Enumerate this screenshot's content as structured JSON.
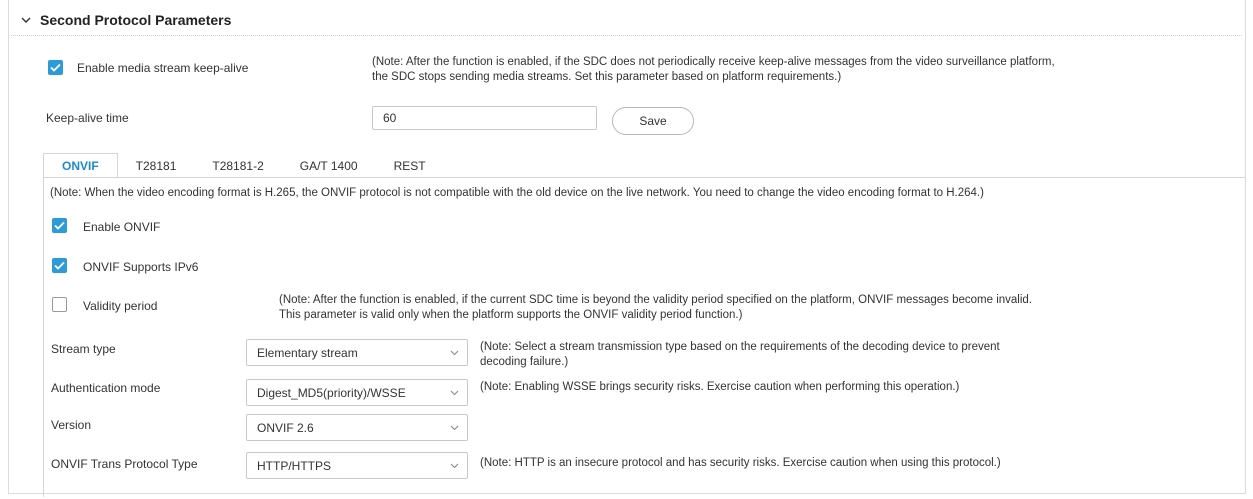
{
  "section": {
    "title": "Second Protocol Parameters"
  },
  "keepalive": {
    "enable_label": "Enable media stream keep-alive",
    "enabled": true,
    "note_line1": "(Note: After the function is enabled, if the SDC does not periodically receive keep-alive messages from the video surveillance platform,",
    "note_line2": "the SDC stops sending media streams. Set this parameter based on platform requirements.)",
    "time_label": "Keep-alive time",
    "time_value": "60",
    "save_label": "Save"
  },
  "tabs": [
    {
      "label": "ONVIF",
      "active": true
    },
    {
      "label": "T28181",
      "active": false
    },
    {
      "label": "T28181-2",
      "active": false
    },
    {
      "label": "GA/T 1400",
      "active": false
    },
    {
      "label": "REST",
      "active": false
    }
  ],
  "onvif": {
    "encoding_note": "(Note: When the video encoding format is H.265, the ONVIF protocol is not compatible with the old device on the live network. You need to change the video encoding format to H.264.)",
    "enable_label": "Enable ONVIF",
    "enable_checked": true,
    "ipv6_label": "ONVIF Supports IPv6",
    "ipv6_checked": true,
    "validity_label": "Validity period",
    "validity_checked": false,
    "validity_note_line1": "(Note: After the function is enabled, if the current SDC time is beyond the validity period specified on the platform, ONVIF messages become invalid.",
    "validity_note_line2": "This parameter is valid only when the platform supports the ONVIF validity period function.)",
    "stream_type_label": "Stream type",
    "stream_type_value": "Elementary stream",
    "stream_type_note_line1": "(Note: Select a stream transmission type based on the requirements of the decoding device to prevent",
    "stream_type_note_line2": "decoding failure.)",
    "auth_label": "Authentication mode",
    "auth_value": "Digest_MD5(priority)/WSSE",
    "auth_note": "(Note: Enabling WSSE brings security risks. Exercise caution when performing this operation.)",
    "version_label": "Version",
    "version_value": "ONVIF 2.6",
    "trans_label": "ONVIF Trans Protocol Type",
    "trans_value": "HTTP/HTTPS",
    "trans_note": "(Note: HTTP is an insecure protocol and has security risks. Exercise caution when using this protocol.)"
  },
  "colors": {
    "accent": "#2e9bd9",
    "tab_active": "#1d8ad1",
    "border": "#d5d5d5"
  },
  "icons": {
    "collapse": "chevron-down-icon",
    "check": "checkmark-icon",
    "dropdown": "chevron-down-icon"
  }
}
